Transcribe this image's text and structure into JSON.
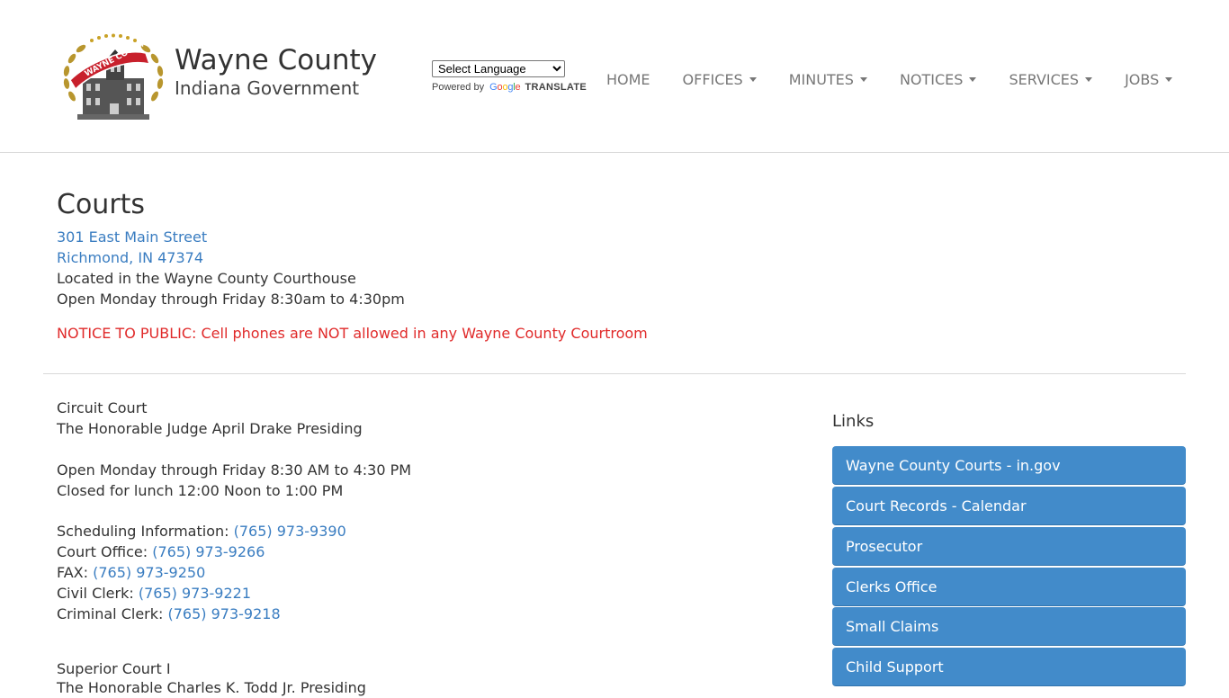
{
  "header": {
    "title": "Wayne County",
    "subtitle": "Indiana Government",
    "logo_text": "WAYNE COUNTY",
    "language_select": {
      "selected": "Select Language"
    },
    "powered_by": "Powered by",
    "google": [
      "G",
      "o",
      "o",
      "g",
      "l",
      "e"
    ],
    "translate": "TRANSLATE",
    "nav": [
      {
        "label": "HOME",
        "dropdown": false
      },
      {
        "label": "OFFICES",
        "dropdown": true
      },
      {
        "label": "MINUTES",
        "dropdown": true
      },
      {
        "label": "NOTICES",
        "dropdown": true
      },
      {
        "label": "SERVICES",
        "dropdown": true
      },
      {
        "label": "JOBS",
        "dropdown": true
      }
    ]
  },
  "page": {
    "title": "Courts",
    "address_line1": "301 East Main Street",
    "address_line2": "Richmond, IN 47374",
    "location": "Located in the Wayne County Courthouse",
    "hours": "Open Monday through Friday 8:30am to 4:30pm",
    "notice": "NOTICE TO PUBLIC: Cell phones are NOT allowed in any Wayne County Courtroom"
  },
  "circuit_court": {
    "name": "Circuit Court",
    "judge": "The Honorable Judge April Drake Presiding",
    "hours": "Open Monday through Friday 8:30 AM to 4:30 PM",
    "lunch": "Closed for lunch 12:00 Noon to 1:00 PM",
    "contacts": [
      {
        "label": "Scheduling Information:",
        "phone": "(765) 973-9390"
      },
      {
        "label": "Court Office:",
        "phone": "(765) 973-9266"
      },
      {
        "label": "FAX:",
        "phone": "(765) 973-9250"
      },
      {
        "label": "Civil Clerk:",
        "phone": "(765) 973-9221"
      },
      {
        "label": "Criminal Clerk:",
        "phone": "(765) 973-9218"
      }
    ]
  },
  "superior_court": {
    "name": "Superior Court I",
    "judge": "The Honorable Charles K. Todd Jr. Presiding"
  },
  "links": {
    "title": "Links",
    "items": [
      "Wayne County Courts - in.gov",
      "Court Records - Calendar",
      "Prosecutor",
      "Clerks Office",
      "Small Claims",
      "Child Support"
    ]
  },
  "colors": {
    "link": "#3a7dc1",
    "notice": "#e02a2a",
    "button": "#428bca"
  }
}
